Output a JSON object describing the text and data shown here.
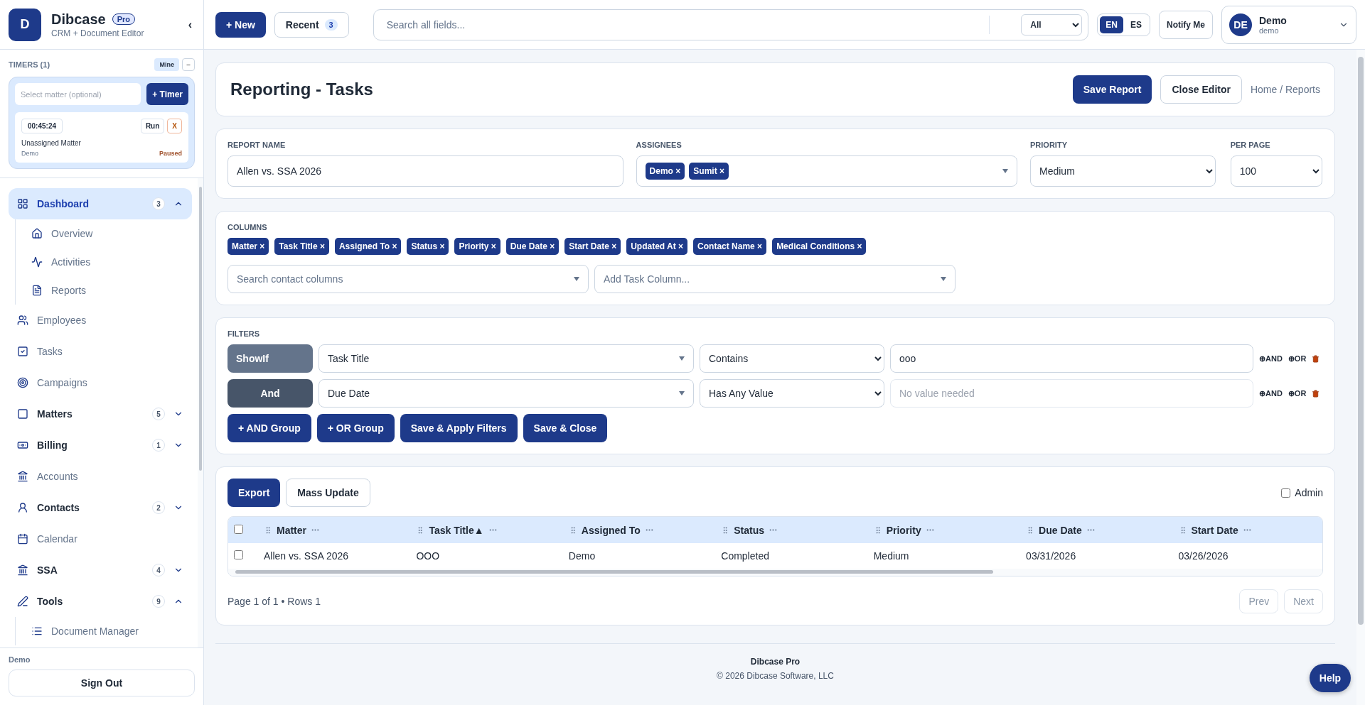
{
  "brand": {
    "initial": "D",
    "name": "Dibcase",
    "badge": "Pro",
    "tagline": "CRM + Document Editor",
    "collapse": "‹"
  },
  "timers": {
    "title": "TIMERS (1)",
    "filter": "Mine",
    "collapse": "–",
    "matter_placeholder": "Select matter (optional)",
    "add": "+ Timer",
    "items": [
      {
        "time": "00:45:24",
        "run": "Run",
        "remove": "X",
        "matter": "Unassigned Matter",
        "owner": "Demo",
        "status": "Paused"
      }
    ]
  },
  "nav": [
    {
      "label": "Dashboard",
      "kind": "group",
      "count": "3",
      "expanded": true,
      "selected": true,
      "children": [
        {
          "label": "Overview",
          "selected": false
        },
        {
          "label": "Activities",
          "selected": false
        },
        {
          "label": "Reports",
          "selected": false
        }
      ]
    },
    {
      "label": "Employees",
      "kind": "link",
      "selected": false
    },
    {
      "label": "Tasks",
      "kind": "link",
      "selected": false
    },
    {
      "label": "Campaigns",
      "kind": "link",
      "selected": false
    },
    {
      "label": "Matters",
      "kind": "group",
      "count": "5",
      "expanded": false,
      "selected": false
    },
    {
      "label": "Billing",
      "kind": "group",
      "count": "1",
      "expanded": false,
      "selected": false
    },
    {
      "label": "Accounts",
      "kind": "link",
      "selected": false
    },
    {
      "label": "Contacts",
      "kind": "group",
      "count": "2",
      "expanded": false,
      "selected": false
    },
    {
      "label": "Calendar",
      "kind": "link",
      "selected": false
    },
    {
      "label": "SSA",
      "kind": "group",
      "count": "4",
      "expanded": false,
      "selected": false
    },
    {
      "label": "Tools",
      "kind": "group",
      "count": "9",
      "expanded": true,
      "selected": false,
      "children": [
        {
          "label": "Document Manager",
          "selected": false
        }
      ]
    }
  ],
  "account": {
    "name": "Demo",
    "sign_out": "Sign Out"
  },
  "topbar": {
    "new": "+ New",
    "recent": {
      "label": "Recent",
      "count": "3"
    },
    "search": {
      "placeholder": "Search all fields...",
      "scope": "All"
    },
    "languages": [
      {
        "label": "EN",
        "selected": true
      },
      {
        "label": "ES",
        "selected": false
      }
    ],
    "notify": "Notify Me",
    "user": {
      "initials": "DE",
      "name": "Demo",
      "username": "demo"
    }
  },
  "page": {
    "title": "Reporting - Tasks",
    "actions": [
      "Save Report",
      "Close Editor"
    ],
    "breadcrumb": "Home / Reports"
  },
  "settings": {
    "report_name": {
      "label": "REPORT NAME",
      "value": "Allen vs. SSA 2026"
    },
    "assignees": {
      "label": "ASSIGNEES",
      "tags": [
        "Demo ×",
        "Sumit ×"
      ]
    },
    "priority": {
      "label": "PRIORITY",
      "value": "Medium"
    },
    "per_page": {
      "label": "PER PAGE",
      "value": "100"
    }
  },
  "columns": {
    "label": "COLUMNS",
    "chips": [
      "Matter ×",
      "Task Title ×",
      "Assigned To ×",
      "Status ×",
      "Priority ×",
      "Due Date ×",
      "Start Date ×",
      "Updated At ×",
      "Contact Name ×",
      "Medical Conditions ×"
    ],
    "search_placeholder": "Search contact columns",
    "add_placeholder": "Add Task Column..."
  },
  "filters": {
    "label": "FILTERS",
    "rows": [
      {
        "kind": "showif",
        "connector": "ShowIf",
        "field": "Task Title",
        "operator": "Contains",
        "value": "ooo",
        "add_and": "⊕AND",
        "add_or": "⊕OR"
      },
      {
        "kind": "and",
        "connector": "And",
        "field": "Due Date",
        "operator": "Has Any Value",
        "placeholder": "No value needed",
        "add_and": "⊕AND",
        "add_or": "⊕OR"
      }
    ],
    "buttons": [
      "+ AND Group",
      "+ OR Group",
      "Save & Apply Filters",
      "Save & Close"
    ]
  },
  "results": {
    "export": "Export",
    "mass_update": "Mass Update",
    "admin": {
      "label": "Admin",
      "checked": false
    },
    "table": {
      "all_selected": false,
      "columns": [
        {
          "label": "Matter"
        },
        {
          "label": "Task Title",
          "sort_mark": "▲"
        },
        {
          "label": "Assigned To"
        },
        {
          "label": "Status"
        },
        {
          "label": "Priority"
        },
        {
          "label": "Due Date"
        },
        {
          "label": "Start Date"
        }
      ],
      "rows": [
        {
          "selected": false,
          "cells": [
            "Allen vs. SSA 2026",
            "OOO",
            "Demo",
            "Completed",
            "Medium",
            "03/31/2026",
            "03/26/2026"
          ]
        }
      ]
    },
    "pagination": {
      "summary": "Page 1 of 1 • Rows 1",
      "prev": {
        "label": "Prev",
        "disabled": true
      },
      "next": {
        "label": "Next",
        "disabled": true
      }
    }
  },
  "footer": {
    "product": "Dibcase Pro",
    "copyright": "© 2026 Dibcase Software, LLC",
    "help": "Help"
  }
}
